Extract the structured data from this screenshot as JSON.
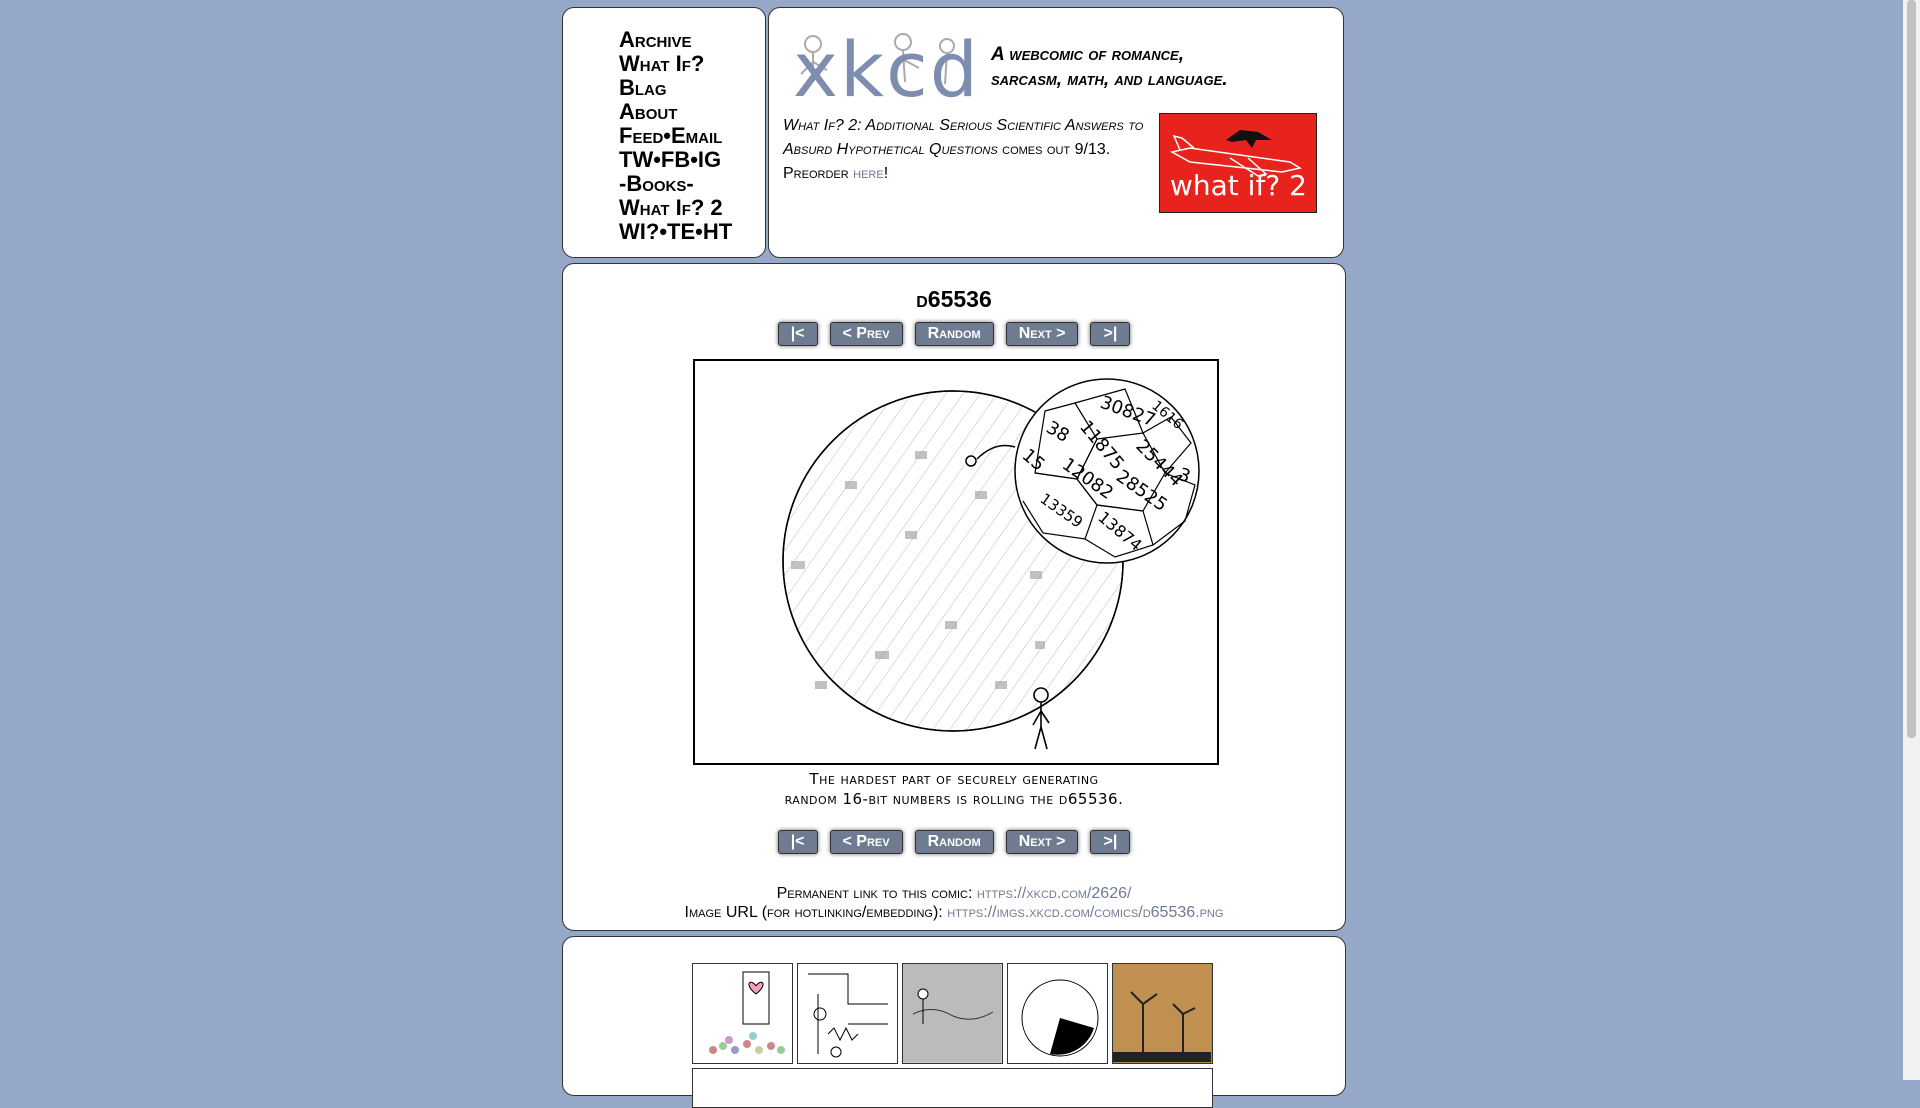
{
  "menu": {
    "items": [
      "Archive",
      "What If?",
      "Blag",
      "About",
      "Feed•Email",
      "TW•FB•IG",
      "-Books-",
      "What If? 2",
      "WI?•TE•HT"
    ]
  },
  "header": {
    "logo": "xkcd",
    "slogan_line1": "A webcomic of romance,",
    "slogan_line2": "sarcasm, math, and language.",
    "promo_line1": "What If? 2: Additional Serious Scientific Answers to",
    "promo_line2_a": "Absurd Hypothetical Questions",
    "promo_line2_b": " comes out 9/13.",
    "promo_line3_a": "Preorder ",
    "promo_link": "here",
    "promo_line3_b": "!",
    "promo_image_text": "what if? 2"
  },
  "comic": {
    "title": "d65536",
    "nav": {
      "first": "|<",
      "prev": "< Prev",
      "random": "Random",
      "next": "Next >",
      "last": ">|"
    },
    "die_numbers": [
      "30827",
      "1616",
      "38",
      "11875",
      "25444",
      "15",
      "12082",
      "28525",
      "3",
      "13359",
      "13874"
    ],
    "caption_line1": "The hardest part of securely generating",
    "caption_line2": "random 16-bit numbers is rolling the d65536.",
    "permalink_label": "Permanent link to this comic: ",
    "permalink": "https://xkcd.com/2626/",
    "image_url_label": "Image URL (for hotlinking/embedding): ",
    "image_url": "https://imgs.xkcd.com/comics/d65536.png"
  },
  "colors": {
    "background": "#96a8c8",
    "nav_button": "#6e7b91",
    "link": "#6e7b91",
    "promo_red": "#e8231d"
  }
}
